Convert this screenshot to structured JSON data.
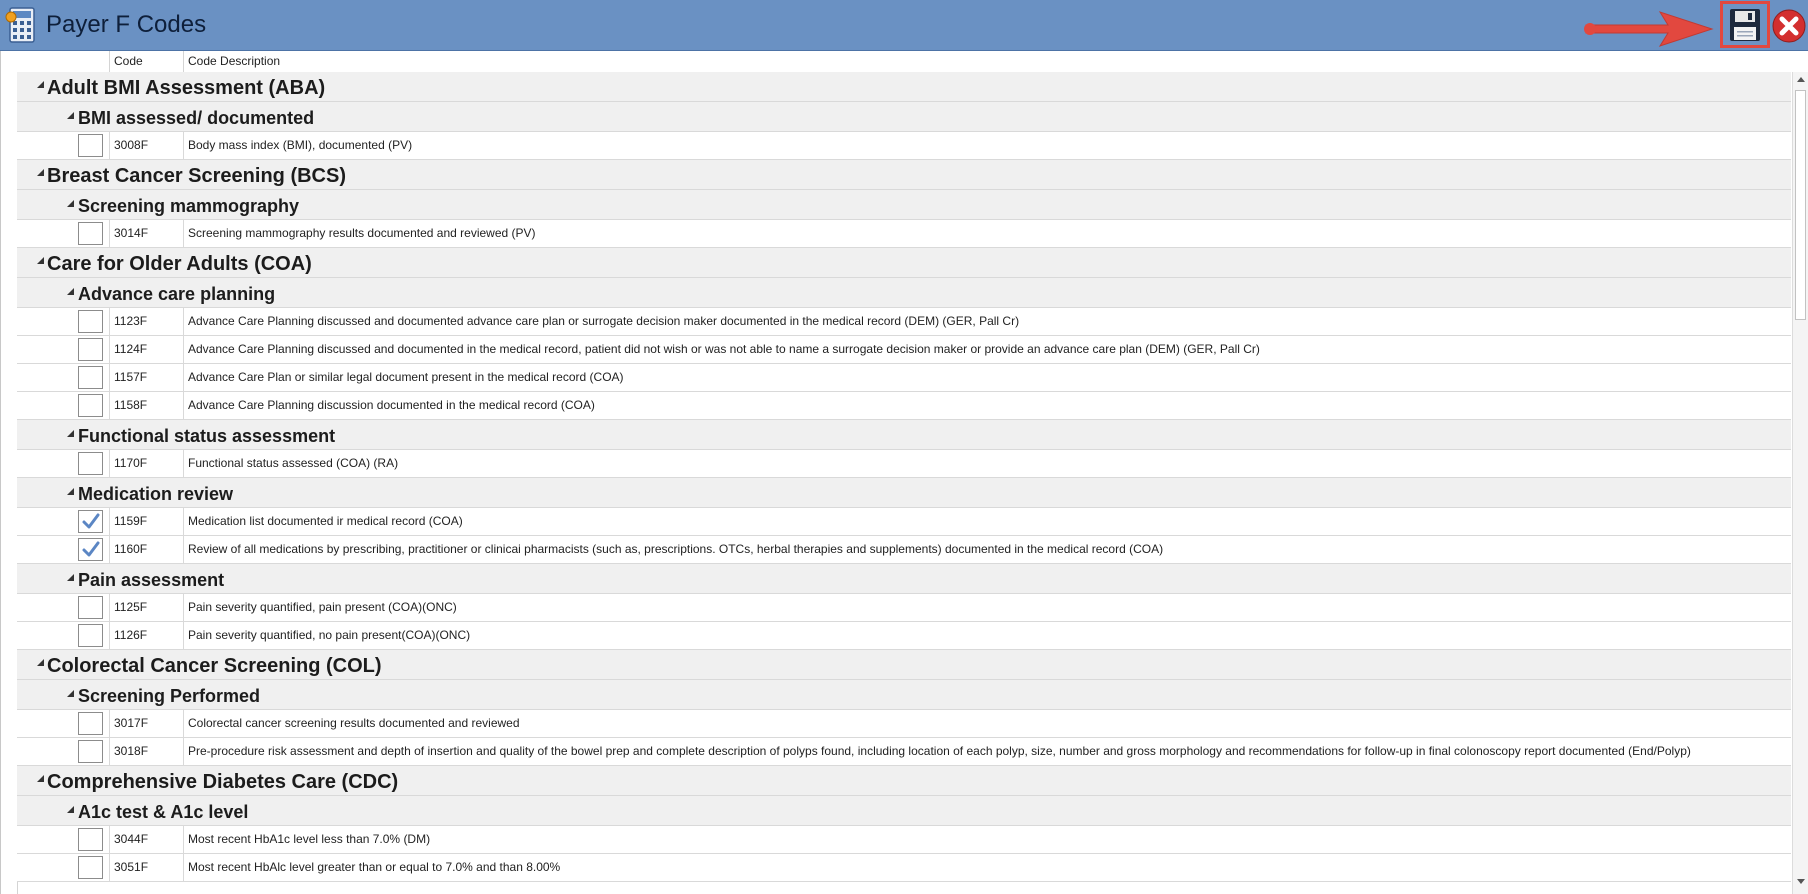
{
  "window": {
    "title": "Payer F Codes"
  },
  "toolbar": {
    "save_label": "Save",
    "close_label": "Close"
  },
  "colors": {
    "titlebar": "#6a91c3",
    "annotation_red": "#e2483f",
    "checkmark": "#5b86c4"
  },
  "grid": {
    "columns": {
      "code": "Code",
      "description": "Code Description"
    },
    "rows": [
      {
        "level": 1,
        "title": "Adult BMI Assessment (ABA)"
      },
      {
        "level": 2,
        "title": "BMI assessed/ documented"
      },
      {
        "level": 3,
        "code": "3008F",
        "desc": "Body mass index (BMI), documented (PV)",
        "checked": false
      },
      {
        "level": 1,
        "title": "Breast Cancer Screening (BCS)"
      },
      {
        "level": 2,
        "title": "Screening mammography"
      },
      {
        "level": 3,
        "code": "3014F",
        "desc": "Screening mammography results documented and reviewed (PV)",
        "checked": false
      },
      {
        "level": 1,
        "title": "Care for Older Adults (COA)"
      },
      {
        "level": 2,
        "title": "Advance care planning"
      },
      {
        "level": 3,
        "code": "1123F",
        "desc": "Advance Care Planning discussed and documented advance care plan or surrogate decision maker documented in the medical record (DEM) (GER, Pall Cr)",
        "checked": false
      },
      {
        "level": 3,
        "code": "1124F",
        "desc": "Advance Care Planning discussed and documented in the medical record, patient did not wish or was not able to name a surrogate decision maker or provide an advance care plan (DEM) (GER, Pall Cr)",
        "checked": false
      },
      {
        "level": 3,
        "code": "1157F",
        "desc": "Advance Care Plan or similar legal document present in the medical record (COA)",
        "checked": false
      },
      {
        "level": 3,
        "code": "1158F",
        "desc": "Advance Care Planning discussion documented in the medical record (COA)",
        "checked": false
      },
      {
        "level": 2,
        "title": "Functional status assessment"
      },
      {
        "level": 3,
        "code": "1170F",
        "desc": "Functional status assessed (COA) (RA)",
        "checked": false
      },
      {
        "level": 2,
        "title": "Medication review"
      },
      {
        "level": 3,
        "code": "1159F",
        "desc": "Medication list documented ir medical record (COA)",
        "checked": true
      },
      {
        "level": 3,
        "code": "1160F",
        "desc": "Review of all medications by prescribing, practitioner or clinicai pharmacists (such as, prescriptions. OTCs, herbal therapies and supplements) documented in the medical record (COA)",
        "checked": true
      },
      {
        "level": 2,
        "title": "Pain assessment"
      },
      {
        "level": 3,
        "code": "1125F",
        "desc": "Pain severity quantified, pain present (COA)(ONC)",
        "checked": false
      },
      {
        "level": 3,
        "code": "1126F",
        "desc": "Pain severity quantified, no pain present(COA)(ONC)",
        "checked": false
      },
      {
        "level": 1,
        "title": "Colorectal Cancer Screening (COL)"
      },
      {
        "level": 2,
        "title": "Screening Performed"
      },
      {
        "level": 3,
        "code": "3017F",
        "desc": "Colorectal cancer screening results documented and reviewed",
        "checked": false
      },
      {
        "level": 3,
        "code": "3018F",
        "desc": "Pre-procedure risk assessment and depth of insertion and quality of the bowel prep and complete description of polyps found, including location of each polyp, size, number and gross morphology and recommendations for follow-up in final colonoscopy report documented (End/Polyp)",
        "checked": false
      },
      {
        "level": 1,
        "title": "Comprehensive Diabetes Care (CDC)"
      },
      {
        "level": 2,
        "title": "A1c test & A1c level"
      },
      {
        "level": 3,
        "code": "3044F",
        "desc": "Most recent HbA1c level less than 7.0% (DM)",
        "checked": false
      },
      {
        "level": 3,
        "code": "3051F",
        "desc": "Most recent HbAlc level greater than or equal to 7.0% and than 8.00%",
        "checked": false
      }
    ]
  }
}
